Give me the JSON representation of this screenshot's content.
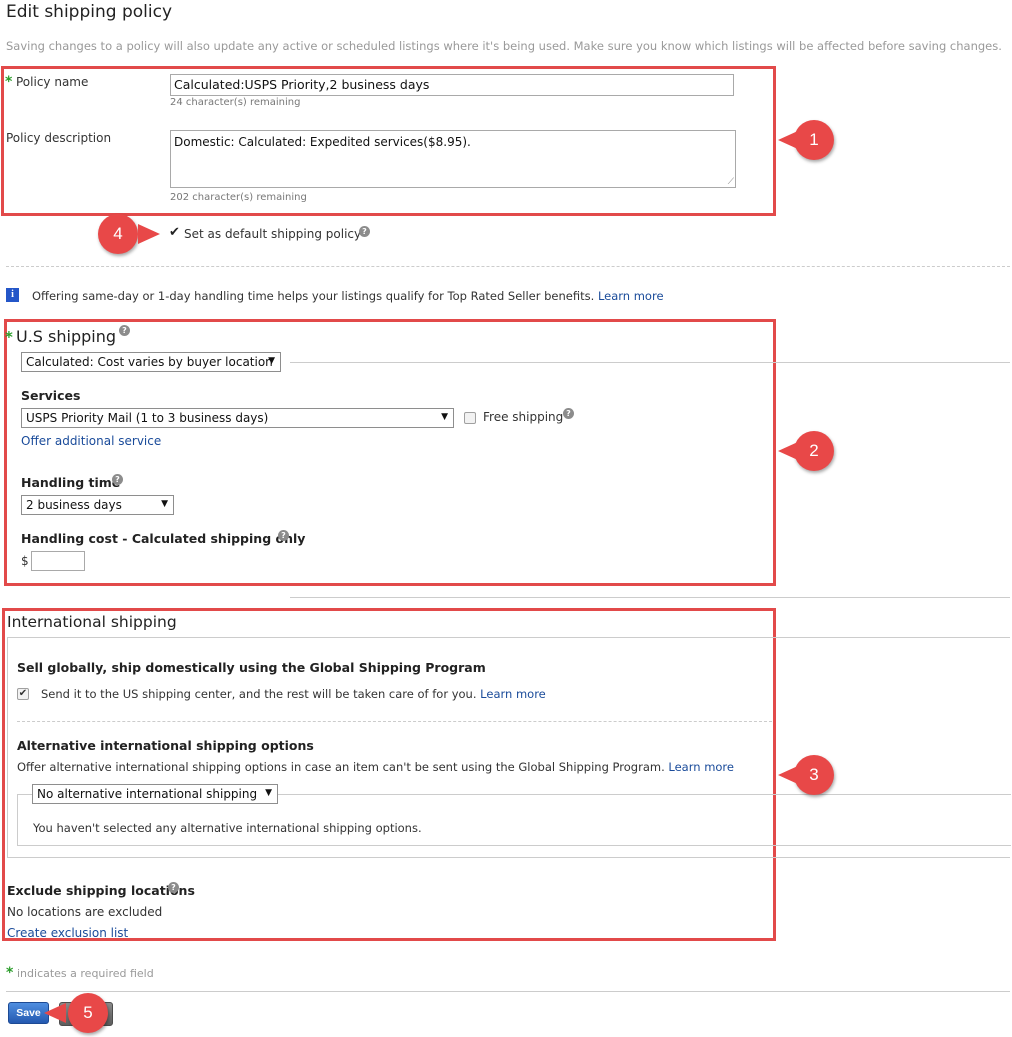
{
  "page": {
    "title": "Edit shipping policy",
    "notice": "Saving changes to a policy will also update any active or scheduled listings where it's being used. Make sure you know which listings will be affected before saving changes."
  },
  "policy": {
    "name_label": "Policy name",
    "name_value": "Calculated:USPS Priority,2 business days",
    "name_remaining": "24 character(s) remaining",
    "description_label": "Policy description",
    "description_value": "Domestic: Calculated: Expedited services($8.95).",
    "description_remaining": "202 character(s) remaining",
    "default_checkmark": "✔",
    "default_label": "Set as default shipping policy"
  },
  "info_banner": {
    "icon": "i",
    "text": "Offering same-day or 1-day handling time helps your listings qualify for Top Rated Seller benefits.",
    "link": "Learn more"
  },
  "us_shipping": {
    "title": "U.S shipping",
    "cost_type": "Calculated: Cost varies by buyer location",
    "services_label": "Services",
    "service_selected": "USPS Priority Mail (1 to 3 business days)",
    "free_shipping_label": "Free shipping",
    "offer_additional_link": "Offer additional service",
    "handling_time_label": "Handling time",
    "handling_time_selected": "2 business days",
    "handling_cost_label": "Handling cost - Calculated shipping only",
    "currency_symbol": "$",
    "handling_cost_value": ""
  },
  "international": {
    "title": "International shipping",
    "gsp_heading": "Sell globally, ship domestically using the Global Shipping Program",
    "gsp_text": "Send it to the US shipping center, and the rest will be taken care of for you.",
    "gsp_link": "Learn more",
    "alt_heading": "Alternative international shipping options",
    "alt_text": "Offer alternative international shipping options in case an item can't be sent using the Global Shipping Program.",
    "alt_link": "Learn more",
    "alt_selected": "No alternative international shipping",
    "alt_none_text": "You haven't selected any alternative international shipping options.",
    "exclude_heading": "Exclude shipping locations",
    "exclude_text": "No locations are excluded",
    "exclude_link": "Create exclusion list"
  },
  "footer": {
    "required_note": "indicates a required field",
    "save_label": "Save",
    "cancel_label": ""
  },
  "callouts": [
    "1",
    "2",
    "3",
    "4",
    "5"
  ],
  "colors": {
    "annotation_red": "#e84848",
    "link_blue": "#1a4b9a",
    "required_green": "#2a9d2a",
    "save_blue": "#2f6fc6"
  }
}
